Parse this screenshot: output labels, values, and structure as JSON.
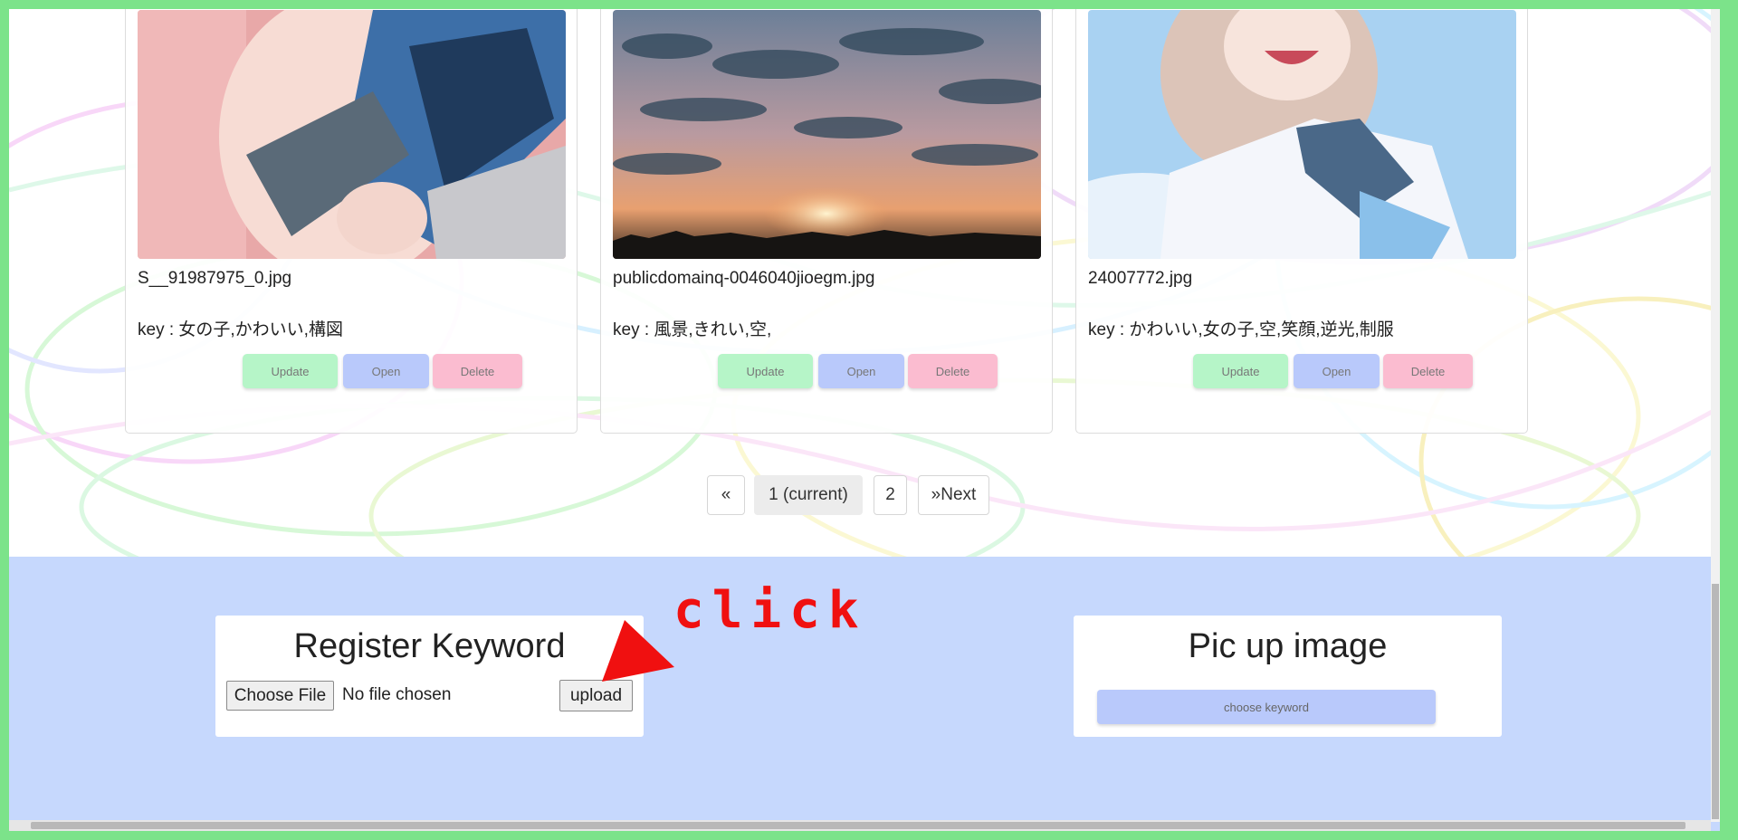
{
  "cards": [
    {
      "filename": "S__91987975_0.jpg",
      "keywords": "key : 女の子,かわいい,構図",
      "update_label": "Update",
      "open_label": "Open",
      "delete_label": "Delete"
    },
    {
      "filename": "publicdomainq-0046040jioegm.jpg",
      "keywords": "key : 風景,きれい,空,",
      "update_label": "Update",
      "open_label": "Open",
      "delete_label": "Delete"
    },
    {
      "filename": "24007772.jpg",
      "keywords": "key : かわいい,女の子,空,笑顔,逆光,制服",
      "update_label": "Update",
      "open_label": "Open",
      "delete_label": "Delete"
    }
  ],
  "pagination": {
    "prev": "«",
    "current": "1 (current)",
    "page2": "2",
    "next": "»Next"
  },
  "register": {
    "title": "Register Keyword",
    "choose_file": "Choose File",
    "no_file": "No file chosen",
    "upload": "upload"
  },
  "pickup": {
    "title": "Pic up image",
    "choose_keyword": "choose keyword"
  },
  "annotation": {
    "text": "click",
    "color": "#f01010"
  },
  "colors": {
    "update": "#b6f5c8",
    "open": "#b9c9fb",
    "delete": "#fbbcd0",
    "footer_bg": "#c6d8fd",
    "border": "#7ce38a"
  }
}
